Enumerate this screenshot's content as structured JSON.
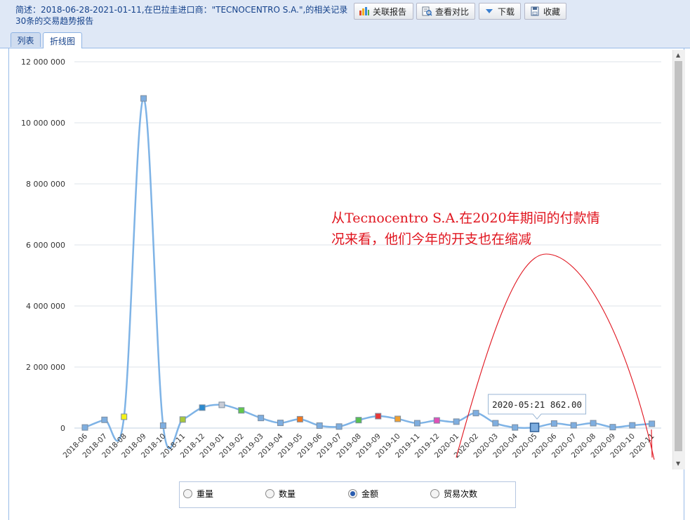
{
  "header": {
    "summary": "简述：2018-06-28-2021-01-11,在巴拉圭进口商：\"TECNOCENTRO S.A.\",的相关记录30条的交易趋势报告",
    "buttons": [
      {
        "label": "关联报告",
        "icon": "chart-report-icon"
      },
      {
        "label": "查看对比",
        "icon": "compare-doc-icon"
      },
      {
        "label": "下载",
        "icon": "download-arrow-icon"
      },
      {
        "label": "收藏",
        "icon": "save-disk-icon"
      }
    ]
  },
  "tabs": [
    {
      "label": "列表",
      "active": false
    },
    {
      "label": "折线图",
      "active": true
    }
  ],
  "tooltip": "2020-05:21 862.00",
  "annotation": {
    "line1": "从Tecnocentro S.A.在2020年期间的付款情",
    "line2": "况来看，他们今年的开支也在缩减",
    "color": "#e0141e"
  },
  "radios": [
    {
      "label": "重量",
      "checked": false
    },
    {
      "label": "数量",
      "checked": false
    },
    {
      "label": "金额",
      "checked": true
    },
    {
      "label": "贸易次数",
      "checked": false
    }
  ],
  "chart_data": {
    "type": "line",
    "categories": [
      "2018-06",
      "2018-07",
      "2018-08",
      "2018-09",
      "2018-10",
      "2018-11",
      "2018-12",
      "2019-01",
      "2019-02",
      "2019-03",
      "2019-04",
      "2019-05",
      "2019-06",
      "2019-07",
      "2019-08",
      "2019-09",
      "2019-10",
      "2019-11",
      "2019-12",
      "2020-01",
      "2020-02",
      "2020-03",
      "2020-04",
      "2020-05",
      "2020-06",
      "2020-07",
      "2020-08",
      "2020-09",
      "2020-10",
      "2020-11"
    ],
    "values": [
      20000,
      270000,
      370000,
      10800000,
      80000,
      280000,
      670000,
      760000,
      580000,
      330000,
      170000,
      290000,
      80000,
      50000,
      260000,
      390000,
      300000,
      160000,
      250000,
      210000,
      490000,
      160000,
      20000,
      21862,
      150000,
      90000,
      160000,
      30000,
      90000,
      140000
    ],
    "marker_colors": [
      "#7eaee0",
      "#7eaee0",
      "#f5f21a",
      "#7eaee0",
      "#7eaee0",
      "#a8c83c",
      "#2a8ad0",
      "#c8ccd6",
      "#62c84a",
      "#7eaee0",
      "#7eaee0",
      "#f07820",
      "#7eaee0",
      "#7eaee0",
      "#58c050",
      "#e83838",
      "#f0a030",
      "#7eaee0",
      "#e050b8",
      "#7eaee0",
      "#7eaee0",
      "#7eaee0",
      "#7eaee0",
      "#7eaee0",
      "#7eaee0",
      "#7eaee0",
      "#7eaee0",
      "#7eaee0",
      "#7eaee0",
      "#7eaee0"
    ],
    "yticks": [
      "12 000 000",
      "10 000 000",
      "8 000 000",
      "6 000 000",
      "4 000 000",
      "2 000 000",
      "0"
    ],
    "ylim": [
      0,
      12000000
    ],
    "line_color": "#7eb3e6",
    "grid": true,
    "highlight_index": 23
  }
}
